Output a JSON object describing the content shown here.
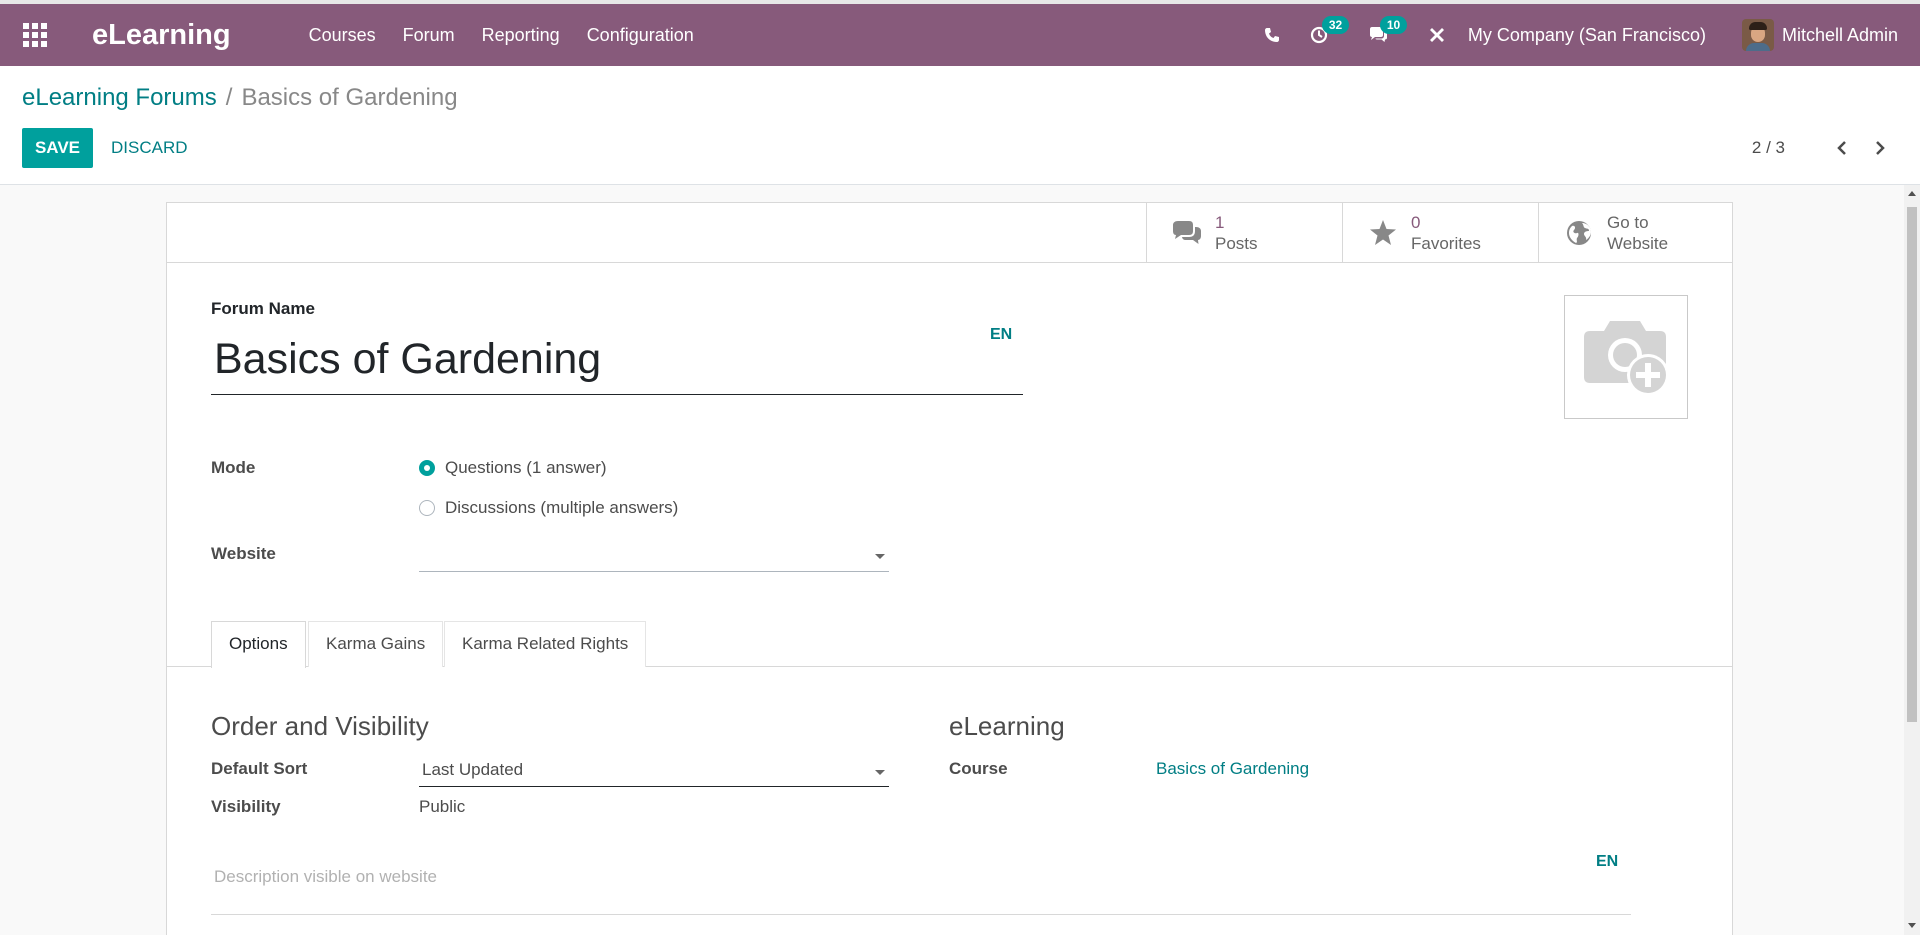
{
  "navbar": {
    "brand": "eLearning",
    "menu": [
      "Courses",
      "Forum",
      "Reporting",
      "Configuration"
    ],
    "activities_count": "32",
    "messages_count": "10",
    "company": "My Company (San Francisco)",
    "user": "Mitchell Admin",
    "color": "#875a7b"
  },
  "breadcrumb": {
    "parent": "eLearning Forums",
    "separator": "/",
    "current": "Basics of Gardening"
  },
  "actions": {
    "save": "SAVE",
    "discard": "DISCARD"
  },
  "pager": {
    "value": "2 / 3"
  },
  "stat_buttons": {
    "posts": {
      "count": "1",
      "label": "Posts"
    },
    "favorites": {
      "count": "0",
      "label": "Favorites"
    },
    "website": {
      "line1": "Go to",
      "line2": "Website"
    }
  },
  "form": {
    "name_label": "Forum Name",
    "name_value": "Basics of Gardening",
    "lang": "EN",
    "mode_label": "Mode",
    "mode_options": [
      "Questions (1 answer)",
      "Discussions (multiple answers)"
    ],
    "mode_selected": "Questions (1 answer)",
    "website_label": "Website",
    "website_value": ""
  },
  "tabs": [
    "Options",
    "Karma Gains",
    "Karma Related Rights"
  ],
  "options": {
    "order_title": "Order and Visibility",
    "default_sort_label": "Default Sort",
    "default_sort_value": "Last Updated",
    "visibility_label": "Visibility",
    "visibility_value": "Public",
    "elearning_title": "eLearning",
    "course_label": "Course",
    "course_value": "Basics of Gardening",
    "description_placeholder": "Description visible on website",
    "description_lang": "EN"
  },
  "accent": "#00a09d"
}
